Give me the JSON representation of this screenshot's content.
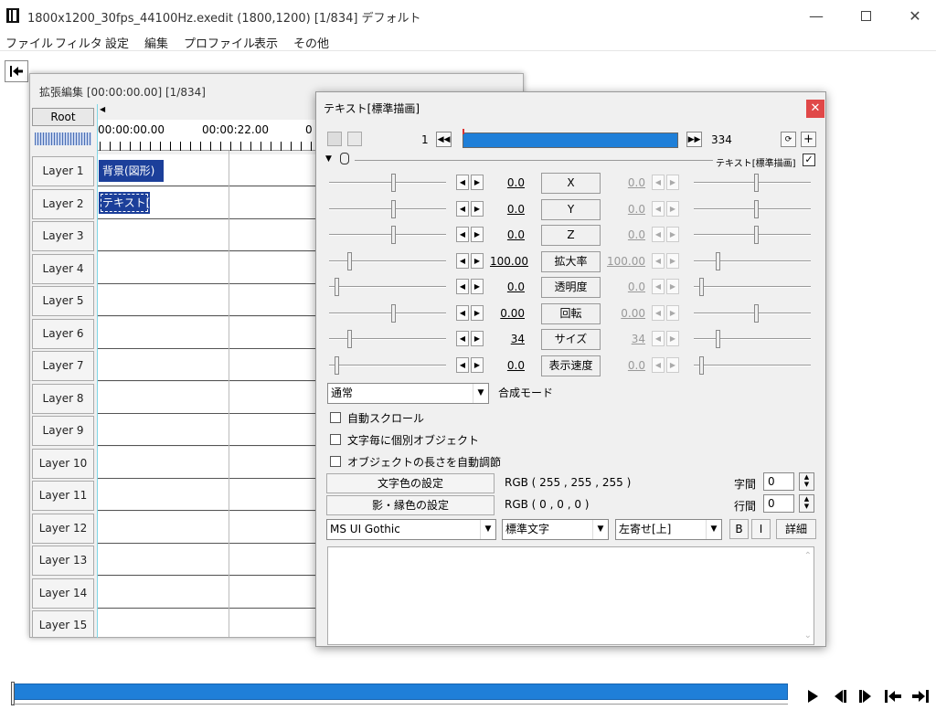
{
  "window": {
    "title": "1800x1200_30fps_44100Hz.exedit (1800,1200)  [1/834]  デフォルト"
  },
  "menu": [
    "ファイル",
    "フィルタ",
    "設定",
    "編集",
    "プロファイル",
    "表示",
    "その他"
  ],
  "ext_edit": {
    "title": "拡張編集 [00:00:00.00] [1/834]",
    "root_label": "Root",
    "ruler_ticks": [
      "00:00:00.00",
      "00:00:22.00",
      "0"
    ],
    "layers": [
      "Layer 1",
      "Layer 2",
      "Layer 3",
      "Layer 4",
      "Layer 5",
      "Layer 6",
      "Layer 7",
      "Layer 8",
      "Layer 9",
      "Layer 10",
      "Layer 11",
      "Layer 12",
      "Layer 13",
      "Layer 14",
      "Layer 15"
    ],
    "clips": [
      {
        "label": "背景(図形)",
        "color": "#1c3f9a"
      },
      {
        "label": "テキスト[標",
        "color": "#1c3f9a"
      }
    ]
  },
  "text_dialog": {
    "title": "テキスト[標準描画]",
    "frame_start": "1",
    "frame_end": "334",
    "object_label": "テキスト[標準描画]",
    "params": [
      {
        "name": "X",
        "value": "0.0",
        "end_value": "0.0"
      },
      {
        "name": "Y",
        "value": "0.0",
        "end_value": "0.0"
      },
      {
        "name": "Z",
        "value": "0.0",
        "end_value": "0.0"
      },
      {
        "name": "拡大率",
        "value": "100.00",
        "end_value": "100.00"
      },
      {
        "name": "透明度",
        "value": "0.0",
        "end_value": "0.0"
      },
      {
        "name": "回転",
        "value": "0.00",
        "end_value": "0.00"
      },
      {
        "name": "サイズ",
        "value": "34",
        "end_value": "34"
      },
      {
        "name": "表示速度",
        "value": "0.0",
        "end_value": "0.0"
      }
    ],
    "blend_mode": "通常",
    "blend_label": "合成モード",
    "checkboxes": [
      "自動スクロール",
      "文字毎に個別オブジェクト",
      "オブジェクトの長さを自動調節"
    ],
    "text_color_btn": "文字色の設定",
    "text_color_value": "RGB ( 255 , 255 , 255 )",
    "shadow_color_btn": "影・縁色の設定",
    "shadow_color_value": "RGB ( 0 , 0 , 0 )",
    "char_spacing_label": "字間",
    "char_spacing": "0",
    "line_spacing_label": "行間",
    "line_spacing": "0",
    "font": "MS UI Gothic",
    "decoration": "標準文字",
    "align": "左寄せ[上]",
    "bold": "B",
    "italic": "I",
    "detail": "詳細"
  }
}
